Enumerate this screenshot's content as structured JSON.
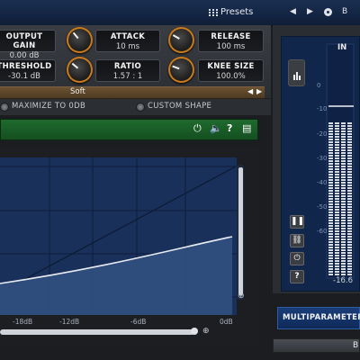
{
  "header": {
    "presets_label": "Presets",
    "prev_label": "◀",
    "next_label": "▶",
    "right_label": "B"
  },
  "params": {
    "output_gain": {
      "label": "OUTPUT GAIN",
      "value": "0.00 dB"
    },
    "attack": {
      "label": "ATTACK",
      "value": "10 ms"
    },
    "release": {
      "label": "RELEASE",
      "value": "100 ms"
    },
    "threshold": {
      "label": "THRESHOLD",
      "value": "-30.1 dB"
    },
    "ratio": {
      "label": "RATIO",
      "value": "1.57 : 1"
    },
    "knee_size": {
      "label": "KNEE SIZE",
      "value": "100.0%"
    }
  },
  "knee": {
    "mode_label": "Soft",
    "left_arrow": "◀",
    "right_arrow": "▶"
  },
  "options": {
    "maximize_label": "MAXIMIZE TO 0DB",
    "custom_shape_label": "CUSTOM SHAPE"
  },
  "toolbar_icons": [
    "power-icon",
    "speaker-icon",
    "help-icon",
    "clipboard-icon"
  ],
  "graph": {
    "db_labels": [
      "-18dB",
      "-12dB",
      "-6dB",
      "0dB"
    ]
  },
  "meter": {
    "in_label": "IN",
    "scale_labels": [
      "0",
      "-10",
      "-20",
      "-30",
      "-40",
      "-50",
      "-60"
    ],
    "in_value": "-16.6",
    "buttons": [
      "pause-icon",
      "link-icon",
      "power-icon",
      "help-icon"
    ]
  },
  "footer": {
    "multiparameter_label": "MULTIPARAMETER",
    "bottom_button_label": "B"
  },
  "colors": {
    "accent_orange": "#c97a1a",
    "bypass_green": "#1f6a2e",
    "graph_blue": "#19305a",
    "header_blue": "#1a2f52"
  }
}
